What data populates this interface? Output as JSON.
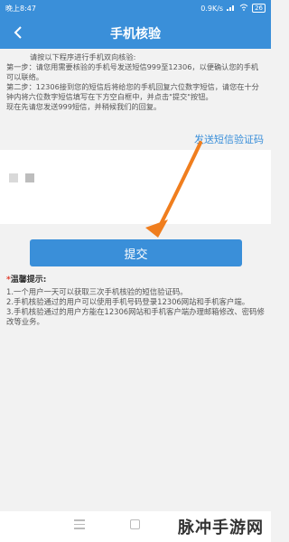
{
  "status_bar": {
    "time": "晚上8:47",
    "network": "0.9K/s",
    "battery": "26"
  },
  "header": {
    "title": "手机核验"
  },
  "instructions": [
    "请按以下程序进行手机双向核验:",
    "第一步：请您用需要核验的手机号发送短信999至12306，以便确认您的手机可以联络。",
    "第二步：12306接到您的短信后将给您的手机回复六位数字短信，请您在十分钟内将六位数字短信填写在下方空白框中，并点击\"提交\"按钮。",
    "现在先请您发送999短信，并稍候我们的回复。"
  ],
  "send_code_label": "发送短信验证码",
  "submit_label": "提交",
  "tips": {
    "star": "*",
    "title": "温馨提示:",
    "items": [
      "1.一个用户一天可以获取三次手机核验的短信验证码。",
      "2.手机核验通过的用户可以使用手机号码登录12306网站和手机客户端。",
      "3.手机核验通过的用户方能在12306网站和手机客户端办理邮箱修改、密码修改等业务。"
    ]
  },
  "watermark": "脉冲手游网",
  "colors": {
    "accent": "#3a8fd9",
    "arrow": "#f07e1e",
    "star": "#e03b2b"
  }
}
